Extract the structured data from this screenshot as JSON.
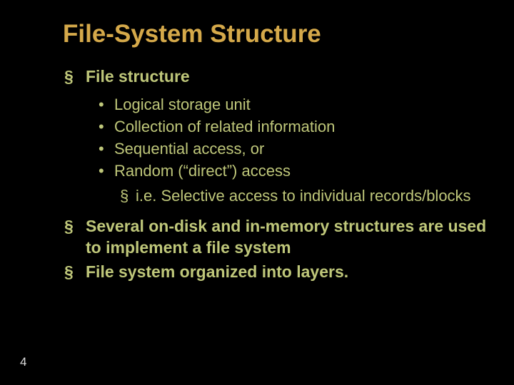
{
  "title": "File-System Structure",
  "bullets": {
    "b1": "File structure",
    "s1": "Logical storage unit",
    "s2": "Collection of related information",
    "s3": "Sequential access, or",
    "s4": "Random (“direct”) access",
    "ss1": "i.e. Selective access to individual records/blocks",
    "b2": "Several on-disk and in-memory structures are used to implement a file system",
    "b3": "File system organized into layers."
  },
  "page_number": "4"
}
